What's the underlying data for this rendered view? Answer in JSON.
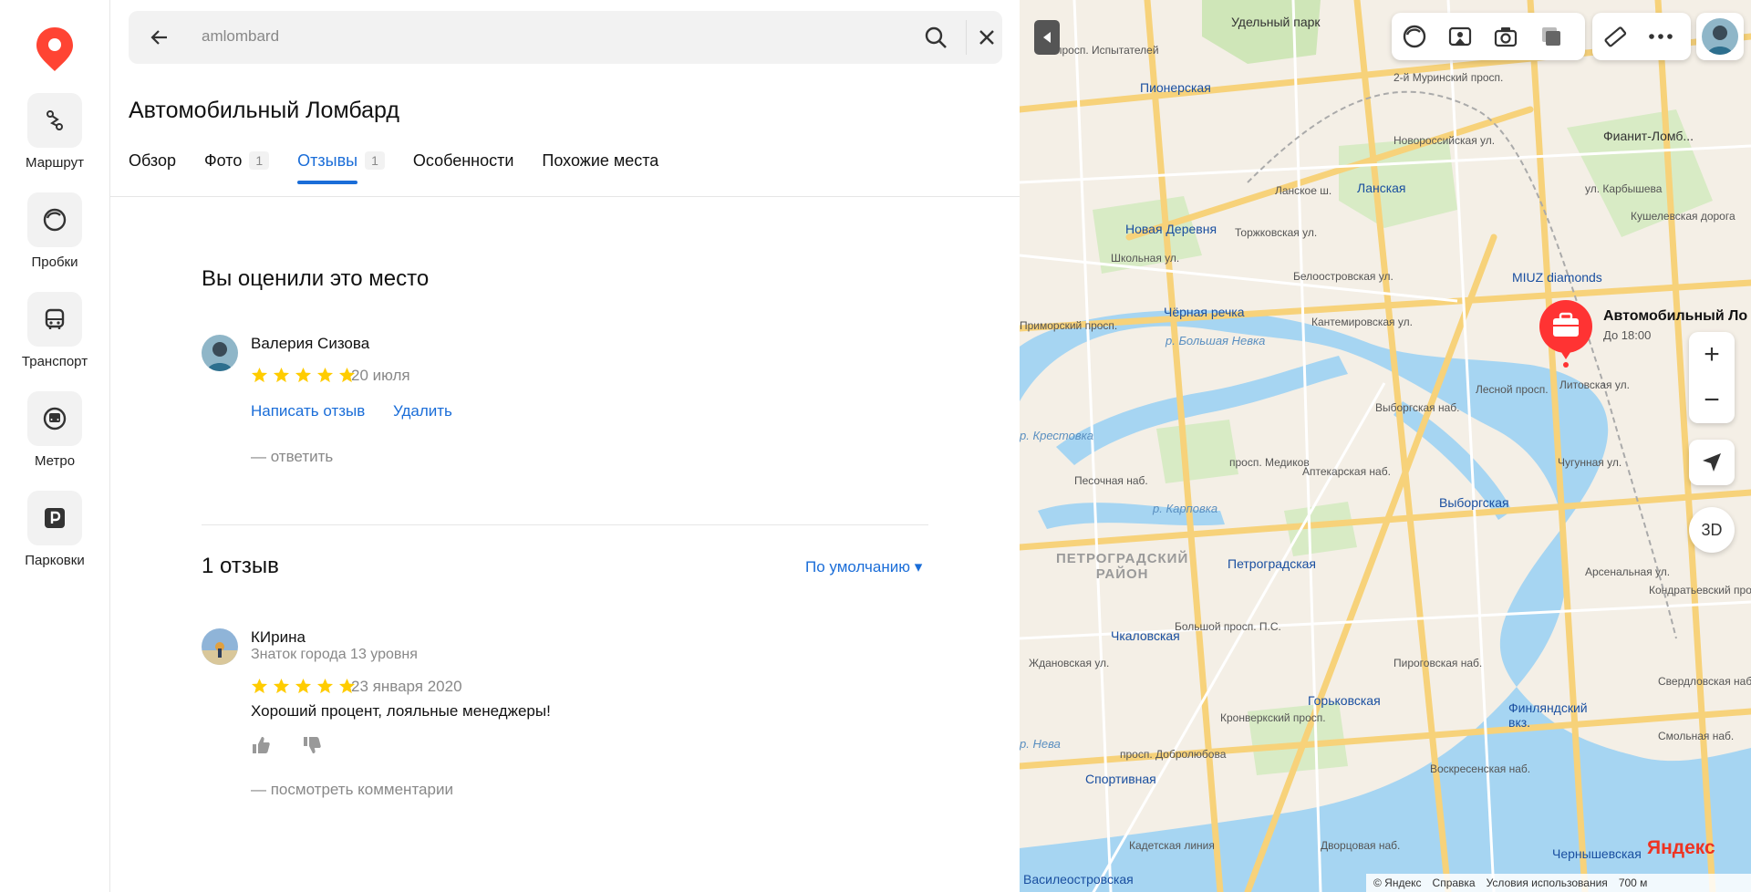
{
  "nav": {
    "items": [
      {
        "label": "Маршрут"
      },
      {
        "label": "Пробки"
      },
      {
        "label": "Транспорт"
      },
      {
        "label": "Метро"
      },
      {
        "label": "Парковки"
      }
    ]
  },
  "search": {
    "query": "amlombard"
  },
  "place": {
    "title": "Автомобильный Ломбард",
    "tabs": [
      {
        "label": "Обзор",
        "count": ""
      },
      {
        "label": "Фото",
        "count": "1"
      },
      {
        "label": "Отзывы",
        "count": "1"
      },
      {
        "label": "Особенности",
        "count": ""
      },
      {
        "label": "Похожие места",
        "count": ""
      }
    ]
  },
  "my_rating": {
    "heading": "Вы оценили это место",
    "user": "Валерия Сизова",
    "stars": 5,
    "date": "20 июля",
    "write_review": "Написать отзыв",
    "delete": "Удалить",
    "reply": "— ответить"
  },
  "reviews": {
    "heading": "1 отзыв",
    "sort": "По умолчанию ▾",
    "items": [
      {
        "author": "КИрина",
        "level": "Знаток города 13 уровня",
        "stars": 5,
        "date": "23 января 2020",
        "text": "Хороший процент, лояльные менеджеры!",
        "comments": "— посмотреть комментарии"
      }
    ]
  },
  "map": {
    "labels": {
      "park": "Удельный парк",
      "ispytateley": "просп. Испытателей",
      "pionerskaya": "Пионерская",
      "murinsky": "2-й Муринский просп.",
      "novorossiyskaya": "Новороссийская ул.",
      "fianit": "Фианит-Ломб...",
      "lanskoe": "Ланское ш.",
      "lanskaya": "Ланская",
      "novaya_derevnya": "Новая Деревня",
      "torzhkovskaya": "Торжковская ул.",
      "shkolnaya": "Школьная ул.",
      "miuz": "MIUZ diamonds",
      "beloostrovskaya": "Белоостровская ул.",
      "kushelevskaya": "Кушелевская дорога",
      "karbysheva": "ул. Карбышева",
      "chernaya_rechka": "Чёрная речка",
      "primorsky": "Приморский просп.",
      "bolshaya_nevka": "р. Большая Невка",
      "kantemirovskaya": "Кантемировская ул.",
      "vyborgskaya_nab": "Выборгская наб.",
      "lesnoy": "Лесной просп.",
      "litovskaya": "Литовская ул.",
      "krestovka": "р. Крестовка",
      "karpovka": "р. Карповка",
      "pesochnaya": "Песочная наб.",
      "medikov": "просп. Медиков",
      "aptekarskaya": "Аптекарская наб.",
      "vyborgskaya": "Выборгская",
      "chugunnaya": "Чугунная ул.",
      "district": "ПЕТРОГРАДСКИЙ\nРАЙОН",
      "petrogradskaya": "Петроградская",
      "chkalovskaya": "Чкаловская",
      "zhdanovskaya": "Ждановская ул.",
      "bolshoy_ps": "Большой просп. П.С.",
      "gorkovskaya": "Горьковская",
      "pirogovskaya": "Пироговская наб.",
      "finlyandsky": "Финляндский\nвкз.",
      "sportivnaya": "Спортивная",
      "dobrolyubova": "просп. Добролюбова",
      "kronverksky": "Кронверкский просп.",
      "voskresenskaya": "Воскресенская наб.",
      "chernyshevskaya": "Чернышевская",
      "dvortsovaya": "Дворцовая наб.",
      "kadetskaya": "Кадетская линия",
      "vasileostrovskaya": "Василеостровская",
      "neva": "р. Нева",
      "sverdlovskaya": "Свердловская наб.",
      "smolnaya": "Смольная наб.",
      "arsenalnaya": "Арсенальная ул.",
      "kondratyevsky": "Кондратьевский просп."
    },
    "pin": {
      "title": "Автомобильный Ло",
      "subtitle": "До 18:00"
    },
    "zoom_in": "+",
    "zoom_out": "−",
    "mode_3d": "3D",
    "brand": "Яндекс",
    "footer": {
      "copyright": "© Яндекс",
      "help": "Справка",
      "terms": "Условия использования",
      "scale": "700 м"
    }
  }
}
